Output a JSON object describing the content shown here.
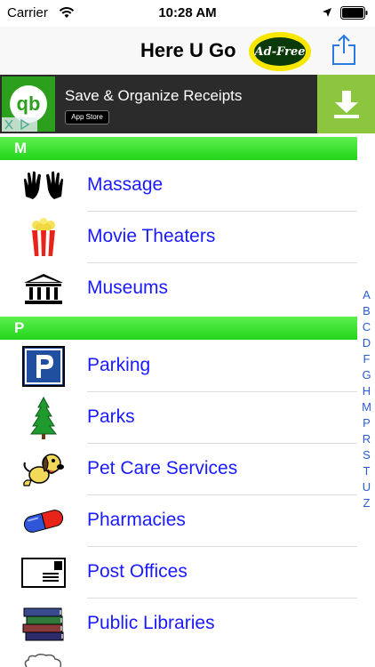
{
  "status": {
    "carrier": "Carrier",
    "time": "10:28 AM"
  },
  "nav": {
    "title": "Here U Go",
    "adfree_label": "Ad-Free"
  },
  "ad": {
    "logo_text": "qb",
    "text": "Save & Organize Receipts",
    "store_label": "App Store"
  },
  "sections": {
    "m": "M",
    "p": "P"
  },
  "items": {
    "massage": "Massage",
    "movie_theaters": "Movie Theaters",
    "museums": "Museums",
    "parking": "Parking",
    "parks": "Parks",
    "pet_care": "Pet Care Services",
    "pharmacies": "Pharmacies",
    "post_offices": "Post Offices",
    "public_libraries": "Public Libraries"
  },
  "index_letters": [
    "A",
    "B",
    "C",
    "D",
    "F",
    "G",
    "H",
    "M",
    "P",
    "R",
    "S",
    "T",
    "U",
    "Z"
  ],
  "colors": {
    "section_green": "#22d41a",
    "link_blue": "#1a1aff",
    "index_blue": "#2a5bd7"
  }
}
